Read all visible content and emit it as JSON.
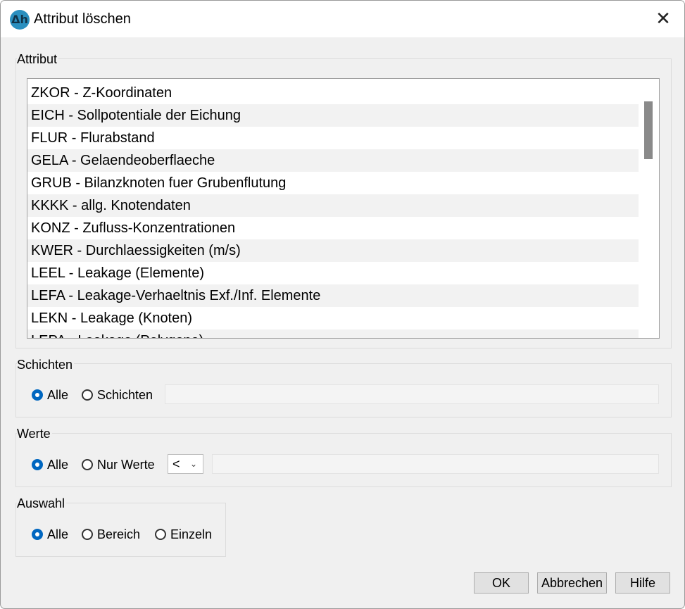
{
  "window": {
    "title": "Attribut löschen",
    "app_icon_text": "Δh",
    "close_glyph": "✕"
  },
  "attribut": {
    "legend": "Attribut",
    "items": [
      "ZKOR - Z-Koordinaten",
      "EICH - Sollpotentiale der Eichung",
      "FLUR - Flurabstand",
      "GELA - Gelaendeoberflaeche",
      "GRUB - Bilanzknoten fuer Grubenflutung",
      "KKKK - allg. Knotendaten",
      "KONZ - Zufluss-Konzentrationen",
      "KWER - Durchlaessigkeiten (m/s)",
      "LEEL - Leakage (Elemente)",
      "LEFA - Leakage-Verhaeltnis Exf./Inf. Elemente",
      "LEKN - Leakage (Knoten)",
      "LEPA - Leakage (Polygone)"
    ]
  },
  "schichten": {
    "legend": "Schichten",
    "option_all": "Alle",
    "option_layers": "Schichten",
    "selected": "Alle",
    "layers_value": ""
  },
  "werte": {
    "legend": "Werte",
    "option_all": "Alle",
    "option_only": "Nur Werte",
    "selected": "Alle",
    "operator": "<",
    "value": ""
  },
  "auswahl": {
    "legend": "Auswahl",
    "option_all": "Alle",
    "option_range": "Bereich",
    "option_single": "Einzeln",
    "selected": "Alle"
  },
  "buttons": {
    "ok": "OK",
    "cancel": "Abbrechen",
    "help": "Hilfe"
  },
  "colors": {
    "accent": "#0067c0",
    "dialog_bg": "#f0f0f0"
  }
}
